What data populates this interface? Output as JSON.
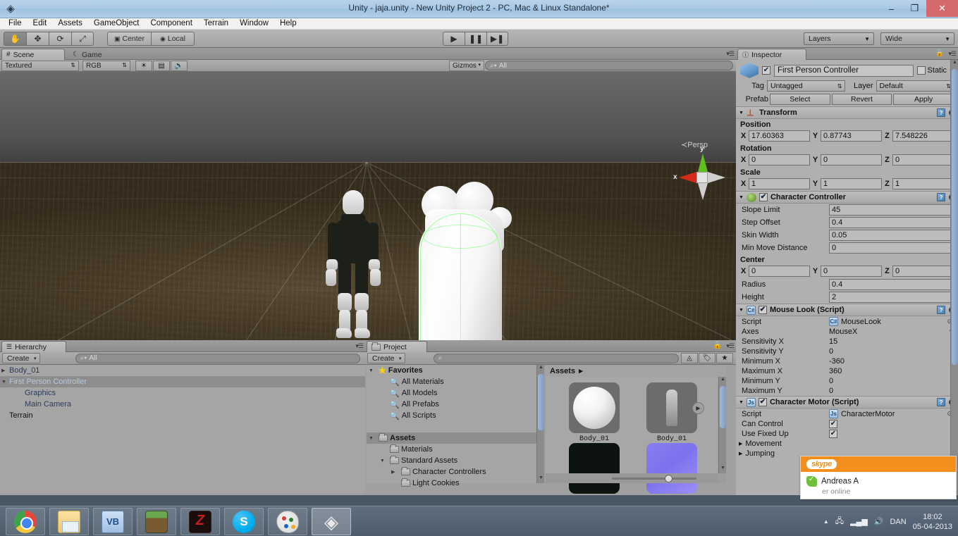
{
  "window": {
    "title": "Unity - jaja.unity - New Unity Project 2 - PC, Mac & Linux Standalone*",
    "logo_icon": "unity-logo-icon",
    "minimize": "–",
    "maximize": "❐",
    "close": "✕"
  },
  "menubar": {
    "items": [
      "File",
      "Edit",
      "Assets",
      "GameObject",
      "Component",
      "Terrain",
      "Window",
      "Help"
    ]
  },
  "toolbar": {
    "transform_tools": [
      {
        "name": "hand-tool",
        "glyph": "✋",
        "active": true
      },
      {
        "name": "move-tool",
        "glyph": "✥",
        "active": false
      },
      {
        "name": "rotate-tool",
        "glyph": "⟳",
        "active": false
      },
      {
        "name": "scale-tool",
        "glyph": "⤢",
        "active": false
      }
    ],
    "pivot_mode": "Center",
    "pivot_rotation": "Local",
    "play": "▶",
    "pause": "❚❚",
    "step": "▶❚",
    "layers_label": "Layers",
    "layout_label": "Wide"
  },
  "scene_panel": {
    "tabs": [
      {
        "label": "Scene",
        "icon": "scene-grid-icon",
        "active": true
      },
      {
        "label": "Game",
        "icon": "game-pacman-icon",
        "active": false
      }
    ],
    "draw_mode": "Textured",
    "render_mode": "RGB",
    "toggle_lighting_icon": "sun-icon",
    "toggle_fx_icon": "image-icon",
    "toggle_audio_icon": "speaker-icon",
    "gizmos_label": "Gizmos",
    "search_placeholder": "All",
    "search_value": "",
    "gizmo": {
      "x_label": "x",
      "y_label": "y",
      "projection": "Persp"
    }
  },
  "hierarchy_panel": {
    "tab_label": "Hierarchy",
    "tab_icon": "hierarchy-list-icon",
    "create_label": "Create",
    "search_placeholder": "All",
    "search_value": "",
    "items": [
      {
        "label": "Body_01",
        "depth": 0,
        "expandable": true,
        "expanded": false,
        "selected": false,
        "style": "prefab"
      },
      {
        "label": "First Person Controller",
        "depth": 0,
        "expandable": true,
        "expanded": true,
        "selected": true,
        "style": "prefab"
      },
      {
        "label": "Graphics",
        "depth": 1,
        "expandable": false,
        "expanded": false,
        "selected": false,
        "style": "prefab"
      },
      {
        "label": "Main Camera",
        "depth": 1,
        "expandable": false,
        "expanded": false,
        "selected": false,
        "style": "prefab"
      },
      {
        "label": "Terrain",
        "depth": 0,
        "expandable": false,
        "expanded": false,
        "selected": false,
        "style": "plain"
      }
    ]
  },
  "project_panel": {
    "tab_label": "Project",
    "tab_icon": "folder-icon",
    "create_label": "Create",
    "search_placeholder": "",
    "search_value": "",
    "filter_type_icon": "filter-by-type-icon",
    "filter_label_icon": "filter-by-label-icon",
    "favorite_icon": "star-icon",
    "tree": [
      {
        "label": "Favorites",
        "depth": 0,
        "icon": "star-icon",
        "tri": "▼",
        "bold": true,
        "selected": false
      },
      {
        "label": "All Materials",
        "depth": 1,
        "icon": "search-icon",
        "tri": "",
        "bold": false,
        "selected": false
      },
      {
        "label": "All Models",
        "depth": 1,
        "icon": "search-icon",
        "tri": "",
        "bold": false,
        "selected": false
      },
      {
        "label": "All Prefabs",
        "depth": 1,
        "icon": "search-icon",
        "tri": "",
        "bold": false,
        "selected": false
      },
      {
        "label": "All Scripts",
        "depth": 1,
        "icon": "search-icon",
        "tri": "",
        "bold": false,
        "selected": false
      },
      {
        "label": "",
        "depth": 0,
        "icon": "",
        "tri": "",
        "bold": false,
        "selected": false
      },
      {
        "label": "Assets",
        "depth": 0,
        "icon": "folder-icon",
        "tri": "▼",
        "bold": true,
        "selected": true
      },
      {
        "label": "Materials",
        "depth": 1,
        "icon": "folder-icon",
        "tri": "",
        "bold": false,
        "selected": false
      },
      {
        "label": "Standard Assets",
        "depth": 1,
        "icon": "folder-icon",
        "tri": "▼",
        "bold": false,
        "selected": false
      },
      {
        "label": "Character Controllers",
        "depth": 2,
        "icon": "folder-icon",
        "tri": "▶",
        "bold": false,
        "selected": false
      },
      {
        "label": "Light Cookies",
        "depth": 2,
        "icon": "folder-icon",
        "tri": "",
        "bold": false,
        "selected": false
      }
    ],
    "breadcrumb": "Assets",
    "breadcrumb_arrow": "▸",
    "assets": [
      {
        "label": "Body_01",
        "kind": "sphere",
        "has_play_badge": false
      },
      {
        "label": "Body_01",
        "kind": "model",
        "has_play_badge": true
      },
      {
        "label": "",
        "kind": "dark",
        "has_play_badge": false
      },
      {
        "label": "",
        "kind": "purple",
        "has_play_badge": false
      }
    ]
  },
  "inspector": {
    "tab_label": "Inspector",
    "tab_icon": "info-icon",
    "lock_icon": "lock-icon",
    "menu_icon": "panel-menu-icon",
    "game_object": {
      "icon": "prefab-cube-icon",
      "enabled": true,
      "name": "First Person Controller",
      "static_label": "Static",
      "static_checked": false,
      "tag_label": "Tag",
      "tag_value": "Untagged",
      "layer_label": "Layer",
      "layer_value": "Default",
      "prefab_label": "Prefab",
      "prefab_buttons": [
        "Select",
        "Revert",
        "Apply"
      ]
    },
    "components": [
      {
        "name": "Transform",
        "icon": "transform-axis-icon",
        "has_checkbox": false,
        "expanded": true,
        "help_icon": "help-book-icon",
        "gear_icon": "gear-icon",
        "groups": [
          {
            "label": "Position",
            "axes": [
              {
                "k": "X",
                "v": "17.60363"
              },
              {
                "k": "Y",
                "v": "0.87743"
              },
              {
                "k": "Z",
                "v": "7.548226"
              }
            ]
          },
          {
            "label": "Rotation",
            "axes": [
              {
                "k": "X",
                "v": "0"
              },
              {
                "k": "Y",
                "v": "0"
              },
              {
                "k": "Z",
                "v": "0"
              }
            ]
          },
          {
            "label": "Scale",
            "axes": [
              {
                "k": "X",
                "v": "1"
              },
              {
                "k": "Y",
                "v": "1"
              },
              {
                "k": "Z",
                "v": "1"
              }
            ]
          }
        ]
      },
      {
        "name": "Character Controller",
        "icon": "character-controller-icon",
        "has_checkbox": true,
        "checked": true,
        "expanded": true,
        "help_icon": "help-book-icon",
        "gear_icon": "gear-icon",
        "props": [
          {
            "label": "Slope Limit",
            "value": "45",
            "type": "field"
          },
          {
            "label": "Step Offset",
            "value": "0.4",
            "type": "field"
          },
          {
            "label": "Skin Width",
            "value": "0.05",
            "type": "field"
          },
          {
            "label": "Min Move Distance",
            "value": "0",
            "type": "field"
          }
        ],
        "groups": [
          {
            "label": "Center",
            "axes": [
              {
                "k": "X",
                "v": "0"
              },
              {
                "k": "Y",
                "v": "0"
              },
              {
                "k": "Z",
                "v": "0"
              }
            ]
          }
        ],
        "props_after": [
          {
            "label": "Radius",
            "value": "0.4",
            "type": "field"
          },
          {
            "label": "Height",
            "value": "2",
            "type": "field"
          }
        ]
      },
      {
        "name": "Mouse Look (Script)",
        "icon": "csharp-script-icon",
        "has_checkbox": true,
        "checked": true,
        "expanded": true,
        "help_icon": "help-book-icon",
        "gear_icon": "gear-icon",
        "props": [
          {
            "label": "Script",
            "value": "MouseLook",
            "type": "object",
            "icon": "csharp-script-icon"
          },
          {
            "label": "Axes",
            "value": "MouseX",
            "type": "enum"
          },
          {
            "label": "Sensitivity X",
            "value": "15",
            "type": "plain"
          },
          {
            "label": "Sensitivity Y",
            "value": "0",
            "type": "plain"
          },
          {
            "label": "Minimum X",
            "value": "-360",
            "type": "plain"
          },
          {
            "label": "Maximum X",
            "value": "360",
            "type": "plain"
          },
          {
            "label": "Minimum Y",
            "value": "0",
            "type": "plain"
          },
          {
            "label": "Maximum Y",
            "value": "0",
            "type": "plain"
          }
        ]
      },
      {
        "name": "Character Motor (Script)",
        "icon": "js-script-icon",
        "has_checkbox": true,
        "checked": true,
        "expanded": true,
        "help_icon": "help-book-icon",
        "gear_icon": "gear-icon",
        "props": [
          {
            "label": "Script",
            "value": "CharacterMotor",
            "type": "object",
            "icon": "js-script-icon"
          },
          {
            "label": "Can Control",
            "value": "",
            "type": "checkbox",
            "checked": true
          },
          {
            "label": "Use Fixed Up",
            "value": "",
            "type": "checkbox",
            "checked": true
          }
        ],
        "foldouts": [
          {
            "label": "Movement",
            "tri": "▶"
          },
          {
            "label": "Jumping",
            "tri": "▶"
          }
        ]
      }
    ]
  },
  "skype_popup": {
    "brand": "skype",
    "contact_name": "Andreas A",
    "status_text": "er online",
    "status_icon": "online-check-icon",
    "brand_color": "#f28f1c"
  },
  "taskbar": {
    "apps": [
      {
        "name": "chrome",
        "class": "ic-chrome",
        "glyph": "",
        "active": false
      },
      {
        "name": "file-explorer",
        "class": "ic-folder",
        "glyph": "",
        "active": false
      },
      {
        "name": "visual-basic",
        "class": "ic-vb",
        "glyph": "VB",
        "active": false
      },
      {
        "name": "minecraft",
        "class": "ic-mc",
        "glyph": "",
        "active": false
      },
      {
        "name": "zombie-game",
        "class": "ic-z",
        "glyph": "",
        "active": false
      },
      {
        "name": "skype",
        "class": "ic-skype",
        "glyph": "S",
        "active": false
      },
      {
        "name": "paint",
        "class": "ic-paint",
        "glyph": "",
        "active": false
      },
      {
        "name": "unity",
        "class": "ic-unity",
        "glyph": "◈",
        "active": true
      }
    ],
    "tray": {
      "show_hidden_icon": "▲",
      "usb_icon": "usb-icon",
      "network_icon": "network-bars-icon",
      "volume_icon": "speaker-icon",
      "language": "DAN",
      "time": "18:02",
      "date": "05-04-2013"
    }
  }
}
